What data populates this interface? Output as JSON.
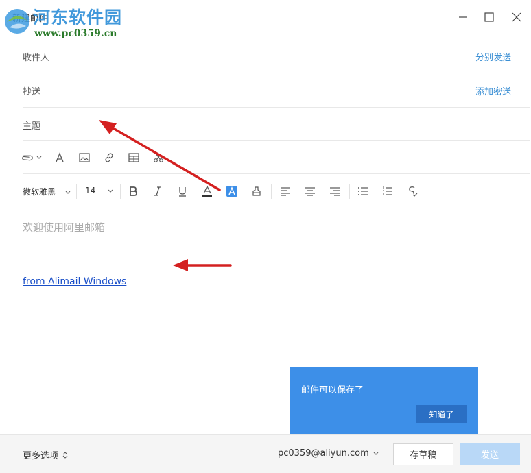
{
  "window": {
    "title": "新建邮件"
  },
  "watermark": {
    "site_name": "河东软件园",
    "url": "www.pc0359.cn"
  },
  "fields": {
    "to_label": "收件人",
    "to_action": "分别发送",
    "cc_label": "抄送",
    "cc_action": "添加密送",
    "subject_label": "主题"
  },
  "format_toolbar": {
    "font": "微软雅黑",
    "size": "14"
  },
  "editor": {
    "placeholder": "欢迎使用阿里邮箱",
    "signature": "from Alimail Windows"
  },
  "popup": {
    "message": "邮件可以保存了",
    "button": "知道了"
  },
  "footer": {
    "more_options": "更多选项",
    "account": "pc0359@aliyun.com",
    "draft": "存草稿",
    "send": "发送"
  },
  "colors": {
    "link": "#3b8fd4",
    "popup_bg": "#3d8fe8",
    "send_disabled": "#b9d8f7",
    "annotation_arrow": "#d42020"
  }
}
